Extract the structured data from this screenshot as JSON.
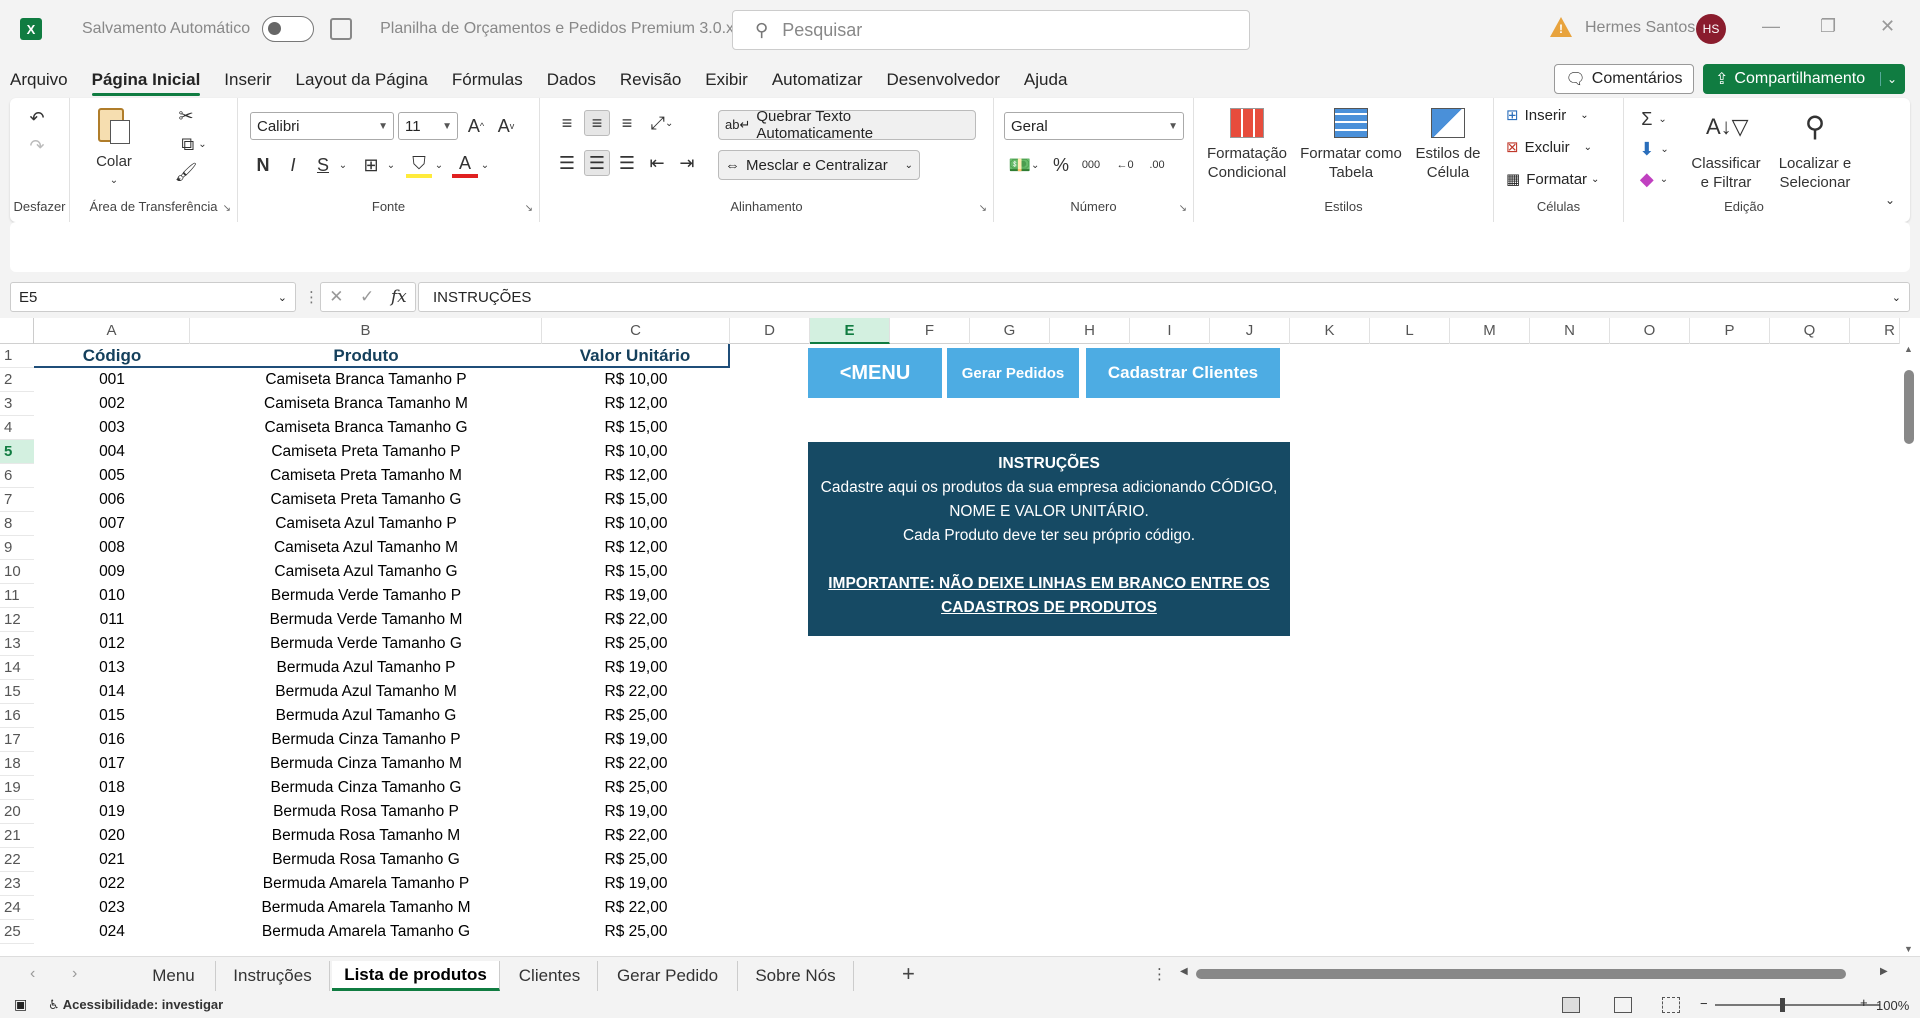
{
  "titlebar": {
    "app_logo": "X",
    "autosave_label": "Salvamento Automático",
    "file_name": "Planilha de Orçamentos e Pedidos Premium 3.0.xlsm",
    "search_placeholder": "Pesquisar",
    "user_name": "Hermes Santos",
    "user_initials": "HS"
  },
  "menu": {
    "tabs": [
      "Arquivo",
      "Página Inicial",
      "Inserir",
      "Layout da Página",
      "Fórmulas",
      "Dados",
      "Revisão",
      "Exibir",
      "Automatizar",
      "Desenvolvedor",
      "Ajuda"
    ],
    "active_tab": "Página Inicial",
    "comments_label": "Comentários",
    "share_label": "Compartilhamento"
  },
  "ribbon": {
    "undo_group": "Desfazer",
    "clipboard": {
      "label": "Área de Transferência",
      "paste": "Colar"
    },
    "font": {
      "label": "Fonte",
      "name": "Calibri",
      "size": "11",
      "bold": "N",
      "italic": "I",
      "underline": "S"
    },
    "alignment": {
      "label": "Alinhamento",
      "wrap": "Quebrar Texto Automaticamente",
      "merge": "Mesclar e Centralizar"
    },
    "number": {
      "label": "Número",
      "format": "Geral",
      "percent": "%",
      "thousands": "000"
    },
    "styles": {
      "label": "Estilos",
      "conditional_1": "Formatação",
      "conditional_2": "Condicional",
      "table_1": "Formatar como",
      "table_2": "Tabela",
      "cell_1": "Estilos de",
      "cell_2": "Célula"
    },
    "cells": {
      "label": "Células",
      "insert": "Inserir",
      "delete": "Excluir",
      "format": "Formatar"
    },
    "editing": {
      "label": "Edição",
      "sort_1": "Classificar",
      "sort_2": "e Filtrar",
      "find_1": "Localizar e",
      "find_2": "Selecionar"
    }
  },
  "formula_bar": {
    "name_box": "E5",
    "fx": "fx",
    "content": "INSTRUÇÕES"
  },
  "columns": [
    "A",
    "B",
    "C",
    "D",
    "E",
    "F",
    "G",
    "H",
    "I",
    "J",
    "K",
    "L",
    "M",
    "N",
    "O",
    "P",
    "Q",
    "R"
  ],
  "rows": [
    "1",
    "2",
    "3",
    "4",
    "5",
    "6",
    "7",
    "8",
    "9",
    "10",
    "11",
    "12",
    "13",
    "14",
    "15",
    "16",
    "17",
    "18",
    "19",
    "20",
    "21",
    "22",
    "23",
    "24",
    "25"
  ],
  "table": {
    "headers": [
      "Código",
      "Produto",
      "Valor Unitário"
    ],
    "rows": [
      [
        "001",
        "Camiseta Branca Tamanho P",
        "R$ 10,00"
      ],
      [
        "002",
        "Camiseta Branca Tamanho M",
        "R$ 12,00"
      ],
      [
        "003",
        "Camiseta Branca Tamanho G",
        "R$ 15,00"
      ],
      [
        "004",
        "Camiseta Preta Tamanho P",
        "R$ 10,00"
      ],
      [
        "005",
        "Camiseta Preta Tamanho M",
        "R$ 12,00"
      ],
      [
        "006",
        "Camiseta Preta Tamanho G",
        "R$ 15,00"
      ],
      [
        "007",
        "Camiseta Azul Tamanho P",
        "R$ 10,00"
      ],
      [
        "008",
        "Camiseta Azul Tamanho M",
        "R$ 12,00"
      ],
      [
        "009",
        "Camiseta Azul Tamanho G",
        "R$ 15,00"
      ],
      [
        "010",
        "Bermuda Verde Tamanho P",
        "R$ 19,00"
      ],
      [
        "011",
        "Bermuda Verde Tamanho M",
        "R$ 22,00"
      ],
      [
        "012",
        "Bermuda Verde Tamanho G",
        "R$ 25,00"
      ],
      [
        "013",
        "Bermuda Azul Tamanho P",
        "R$ 19,00"
      ],
      [
        "014",
        "Bermuda Azul Tamanho M",
        "R$ 22,00"
      ],
      [
        "015",
        "Bermuda Azul Tamanho G",
        "R$ 25,00"
      ],
      [
        "016",
        "Bermuda Cinza Tamanho P",
        "R$ 19,00"
      ],
      [
        "017",
        "Bermuda Cinza Tamanho M",
        "R$ 22,00"
      ],
      [
        "018",
        "Bermuda Cinza Tamanho G",
        "R$ 25,00"
      ],
      [
        "019",
        "Bermuda Rosa Tamanho P",
        "R$ 19,00"
      ],
      [
        "020",
        "Bermuda Rosa Tamanho M",
        "R$ 22,00"
      ],
      [
        "021",
        "Bermuda Rosa Tamanho G",
        "R$ 25,00"
      ],
      [
        "022",
        "Bermuda Amarela Tamanho P",
        "R$ 19,00"
      ],
      [
        "023",
        "Bermuda Amarela Tamanho M",
        "R$ 22,00"
      ],
      [
        "024",
        "Bermuda Amarela Tamanho G",
        "R$ 25,00"
      ]
    ]
  },
  "sheet_buttons": {
    "menu": "<MENU",
    "orders": "Gerar Pedidos",
    "clients": "Cadastrar Clientes"
  },
  "instructions": {
    "title": "INSTRUÇÕES",
    "line1": "Cadastre aqui os produtos da sua empresa adicionando CÓDIGO,",
    "line2": "NOME E VALOR UNITÁRIO.",
    "line3": "Cada Produto deve ter seu próprio código.",
    "important1": "IMPORTANTE: NÃO DEIXE LINHAS EM BRANCO ENTRE OS",
    "important2": "CADASTROS DE PRODUTOS"
  },
  "sheet_tabs": [
    "Menu",
    "Instruções",
    "Lista de produtos",
    "Clientes",
    "Gerar Pedido",
    "Sobre Nós"
  ],
  "active_sheet": "Lista de produtos",
  "status": {
    "accessibility": "Acessibilidade: investigar",
    "zoom": "100%"
  },
  "colors": {
    "accent": "#107c41",
    "button_blue": "#4dace3",
    "instructions_bg": "#164a64",
    "header_text": "#15405c"
  }
}
